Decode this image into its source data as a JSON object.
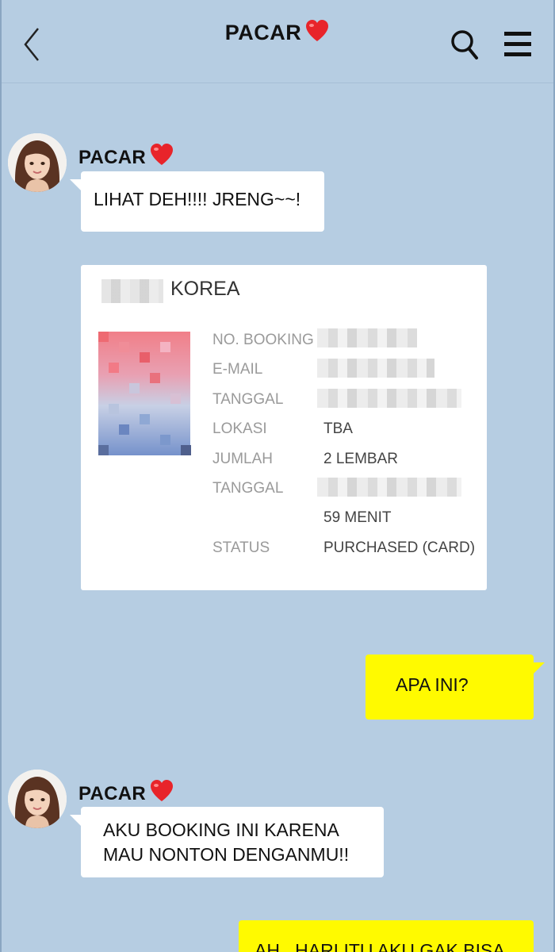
{
  "header": {
    "title": "PACAR",
    "back_icon": "chevron-left-icon",
    "search_icon": "search-icon",
    "menu_icon": "hamburger-menu-icon"
  },
  "messages": [
    {
      "sender": "PACAR",
      "text": "LIHAT DEH!!!! JRENG~~!"
    },
    {
      "sender": "PACAR",
      "card": {
        "title": "KOREA",
        "rows": [
          {
            "label": "NO. BOOKING",
            "value": ""
          },
          {
            "label": "E-MAIL",
            "value": ""
          },
          {
            "label": "TANGGAL",
            "value": ""
          },
          {
            "label": "LOKASI",
            "value": "TBA"
          },
          {
            "label": "JUMLAH",
            "value": "2 LEMBAR"
          },
          {
            "label": "TANGGAL",
            "value": ""
          },
          {
            "label": "",
            "value": "59 MENIT"
          },
          {
            "label": "STATUS",
            "value": "PURCHASED (CARD)"
          }
        ]
      }
    },
    {
      "sender": "me",
      "text": "APA INI?"
    },
    {
      "sender": "PACAR",
      "lines": [
        "AKU BOOKING INI KARENA",
        "MAU NONTON DENGANMU!!"
      ]
    },
    {
      "sender": "me",
      "text": "AH.. HARI ITU AKU GAK BISA"
    }
  ],
  "colors": {
    "background": "#b6cde2",
    "my_bubble": "#fffa00",
    "their_bubble": "#ffffff",
    "heart": "#e8242a"
  }
}
